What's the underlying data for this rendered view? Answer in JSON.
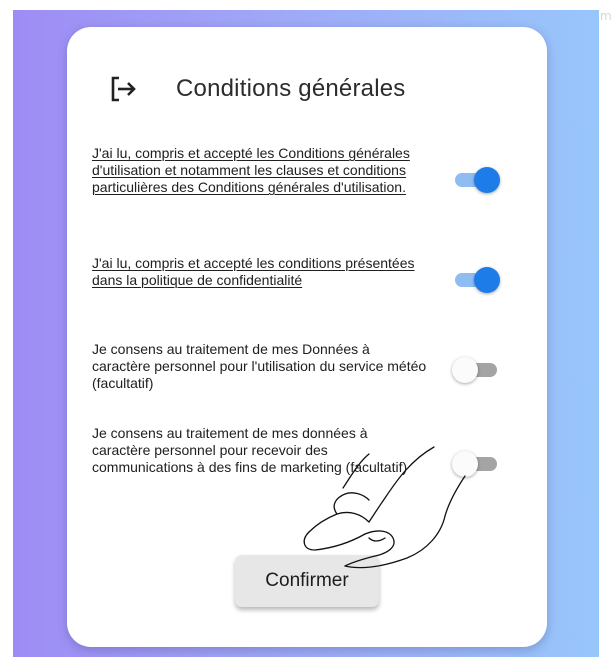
{
  "header": {
    "icon": "logout-arrow-icon",
    "title": "Conditions générales"
  },
  "consents": [
    {
      "text": "J'ai lu, compris et accepté les Conditions générales d'utilisation et notamment les clauses et conditions particulières des Conditions générales d'utilisation.",
      "underlined": true,
      "enabled": true
    },
    {
      "text": "J'ai lu, compris et accepté les conditions présentées dans la politique de confidentialité",
      "underlined": true,
      "enabled": true
    },
    {
      "text": "Je consens au traitement de mes Données à caractère personnel pour l'utilisation du service météo (facultatif)",
      "underlined": false,
      "enabled": false
    },
    {
      "text": "Je consens au traitement de mes données à caractère personnel pour recevoir des communications à des fins de marketing (facultatif)",
      "underlined": false,
      "enabled": false
    }
  ],
  "confirm_label": "Confirmer",
  "overlay": {
    "icon": "pointing-hand-icon"
  },
  "colors": {
    "background_start": "#9e8cf5",
    "background_end": "#98c6fb",
    "toggle_on_thumb": "#1e7ce8",
    "toggle_on_track": "#8fbdf1",
    "toggle_off_thumb": "#fbfbfb",
    "toggle_off_track": "#a4a4a4",
    "button_background": "#e7e7e7"
  }
}
